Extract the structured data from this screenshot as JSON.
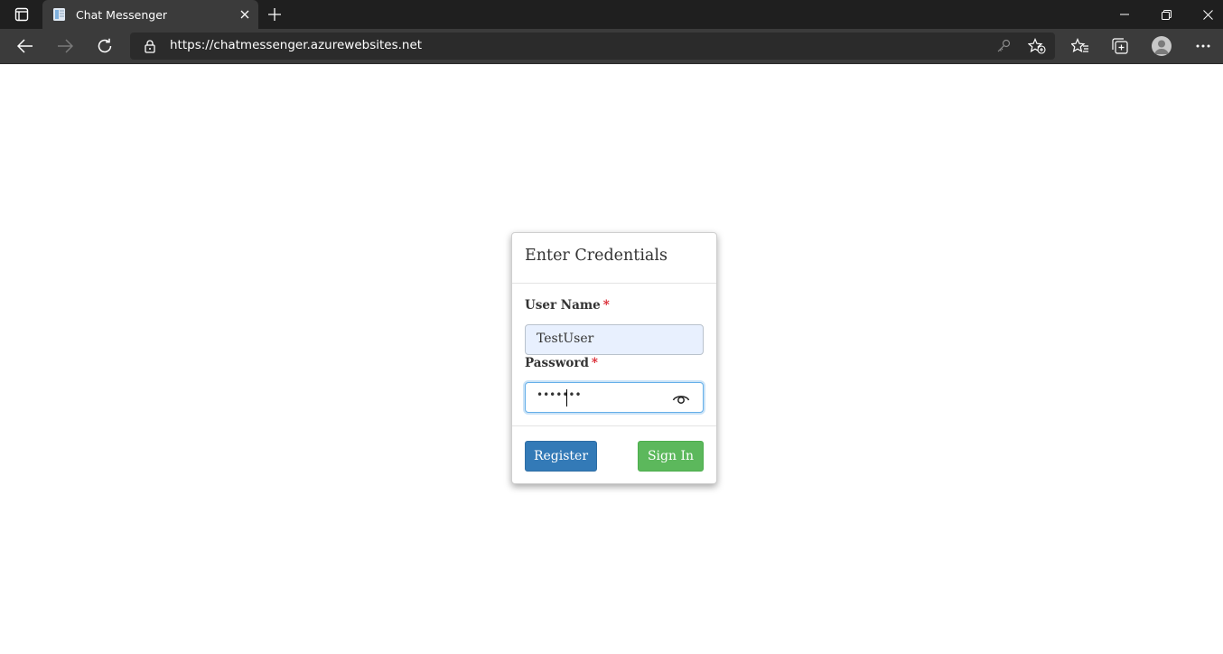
{
  "browser": {
    "tab_title": "Chat Messenger",
    "url": "https://chatmessenger.azurewebsites.net"
  },
  "login": {
    "title": "Enter Credentials",
    "username_label": "User Name",
    "username_value": "TestUser",
    "password_label": "Password",
    "password_masked": "•••••••",
    "required_marker": "*",
    "register_label": "Register",
    "signin_label": "Sign In"
  },
  "colors": {
    "register": "#337ab7",
    "signin": "#5cb85c",
    "required": "#d9232d"
  }
}
